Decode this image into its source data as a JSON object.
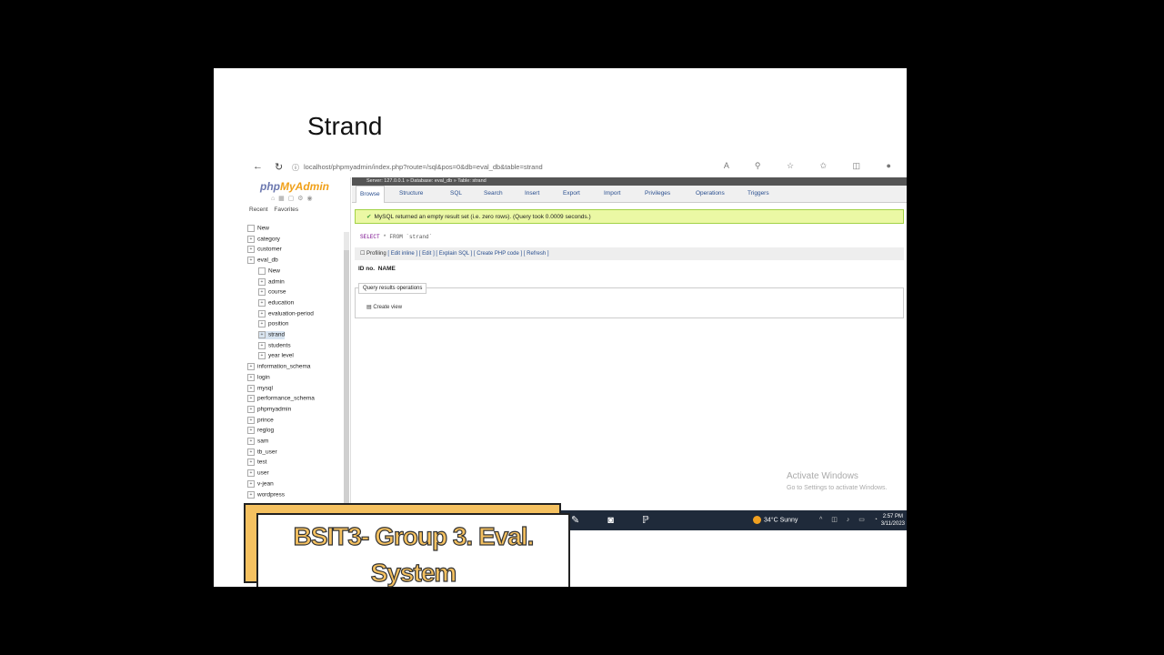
{
  "slide": {
    "title": "Strand"
  },
  "browser": {
    "url": "localhost/phpmyadmin/index.php?route=/sql&pos=0&db=eval_db&table=strand"
  },
  "pma": {
    "logo_php": "php",
    "logo_myadmin": "MyAdmin",
    "left_tabs": [
      "Recent",
      "Favorites"
    ],
    "tree": [
      {
        "label": "New",
        "level": 0
      },
      {
        "label": "category",
        "level": 0
      },
      {
        "label": "customer",
        "level": 0
      },
      {
        "label": "eval_db",
        "level": 0
      },
      {
        "label": "New",
        "level": 1
      },
      {
        "label": "admin",
        "level": 1
      },
      {
        "label": "course",
        "level": 1
      },
      {
        "label": "education",
        "level": 1
      },
      {
        "label": "evaluation-period",
        "level": 1
      },
      {
        "label": "position",
        "level": 1
      },
      {
        "label": "strand",
        "level": 1
      },
      {
        "label": "students",
        "level": 1
      },
      {
        "label": "year level",
        "level": 1
      },
      {
        "label": "information_schema",
        "level": 0
      },
      {
        "label": "login",
        "level": 0
      },
      {
        "label": "mysql",
        "level": 0
      },
      {
        "label": "performance_schema",
        "level": 0
      },
      {
        "label": "phpmyadmin",
        "level": 0
      },
      {
        "label": "prince",
        "level": 0
      },
      {
        "label": "reglog",
        "level": 0
      },
      {
        "label": "sam",
        "level": 0
      },
      {
        "label": "tb_user",
        "level": 0
      },
      {
        "label": "test",
        "level": 0
      },
      {
        "label": "user",
        "level": 0
      },
      {
        "label": "v-jean",
        "level": 0
      },
      {
        "label": "wordpress",
        "level": 0
      }
    ],
    "serverbar": "Server: 127.0.0.1 » Database: eval_db » Table: strand",
    "tabs": [
      "Browse",
      "Structure",
      "SQL",
      "Search",
      "Insert",
      "Export",
      "Import",
      "Privileges",
      "Operations",
      "Triggers"
    ],
    "success_msg": "MySQL returned an empty result set (i.e. zero rows). (Query took 0.0009 seconds.)",
    "sql_kw1": "SELECT",
    "sql_rest": "* FROM `strand`",
    "profiling": "Profiling",
    "prof_links": "[ Edit inline ] [ Edit ] [ Explain SQL ] [ Create PHP code ] [ Refresh ]",
    "col_id": "ID no.",
    "col_name": "NAME",
    "qro_legend": "Query results operations",
    "create_view": "Create view"
  },
  "activate": {
    "title": "Activate Windows",
    "sub": "Go to Settings to activate Windows."
  },
  "taskbar": {
    "weather": "34°C Sunny",
    "time": "2:57 PM",
    "date": "3/11/2023"
  },
  "caption": {
    "line1": "BSIT3- Group 3. Eval.",
    "line2": "System"
  },
  "colors": {
    "caption_fill": "#f5c160",
    "logo_orange": "#f0a019",
    "logo_blue": "#6c78af",
    "success_bg": "#ebf8a4"
  }
}
